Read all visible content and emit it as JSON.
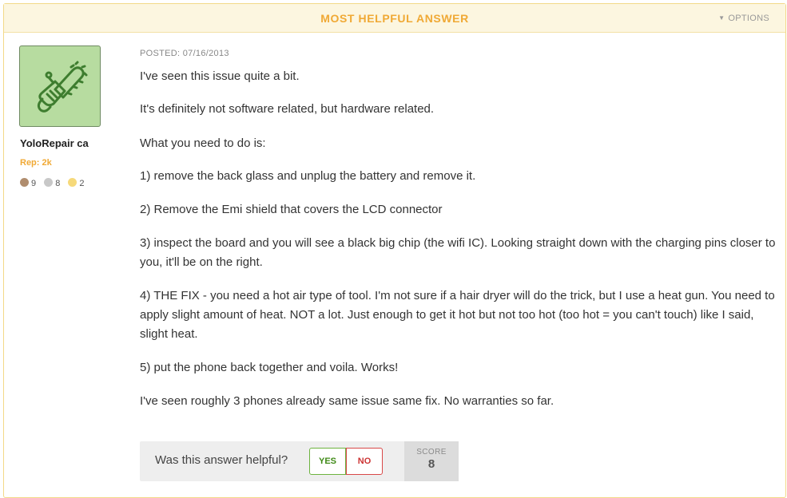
{
  "banner": {
    "title": "MOST HELPFUL ANSWER",
    "options_label": "OPTIONS"
  },
  "author": {
    "name": "YoloRepair ca",
    "rep": "Rep: 2k",
    "badges": [
      {
        "color": "#b08d6e",
        "count": "9"
      },
      {
        "color": "#c8c8c8",
        "count": "8"
      },
      {
        "color": "#f6d97a",
        "count": "2"
      }
    ],
    "avatar_icon": "chainsaw-icon",
    "avatar_bg": "#b7dca0",
    "avatar_fg": "#3e7d2f"
  },
  "answer": {
    "posted": "POSTED: 07/16/2013",
    "paragraphs": [
      "I've seen this issue quite a bit.",
      "It's definitely not software related, but hardware related.",
      "What you need to do is:",
      "1) remove the back glass and unplug the battery and remove it.",
      "2) Remove the Emi shield that covers the LCD connector",
      "3) inspect the board and you will see a black big chip (the wifi IC). Looking straight down with the charging pins closer to you, it'll be on the right.",
      "4) THE FIX - you need a hot air type of tool. I'm not sure if a hair dryer will do the trick, but I use a heat gun. You need to apply slight amount of heat. NOT a lot. Just enough to get it hot but not too hot (too hot = you can't touch) like I said, slight heat.",
      "5) put the phone back together and voila. Works!",
      "I've seen roughly 3 phones already same issue same fix. No warranties so far."
    ]
  },
  "feedback": {
    "question": "Was this answer helpful?",
    "yes_label": "YES",
    "no_label": "NO",
    "score_label": "SCORE",
    "score_value": "8"
  },
  "colors": {
    "accent": "#f0a935",
    "banner_bg": "#fcf6e0",
    "yes": "#6db33f",
    "no": "#d94848"
  }
}
